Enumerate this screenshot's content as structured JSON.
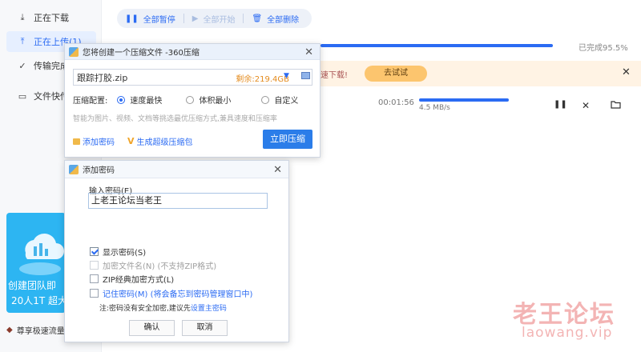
{
  "sidebar": {
    "items": [
      {
        "label": "正在下载",
        "icon": "download-icon"
      },
      {
        "label": "正在上传(1)",
        "icon": "upload-icon"
      },
      {
        "label": "传输完成",
        "icon": "check-circle-icon"
      },
      {
        "label": "文件快传",
        "icon": "monitor-icon"
      }
    ],
    "promo": {
      "line1": "创建团队即",
      "line2": "20人1T 超大"
    },
    "speed_label": "尊享极速流量"
  },
  "toolbar": {
    "pause_all": "全部暂停",
    "start_all": "全部开始",
    "delete_all": "全部删除"
  },
  "transfer": {
    "done_label": "已完成95.5%",
    "notice_text": "速下载!",
    "try_button": "去试试",
    "time": "00:01:56",
    "speed": "4.5 MB/s"
  },
  "compress_dialog": {
    "title": "您将创建一个压缩文件 -360压缩",
    "filename": "跟踪打胶.zip",
    "remaining": "剩余:219.4GB",
    "config_label": "压缩配置:",
    "options": [
      "速度最快",
      "体积最小",
      "自定义"
    ],
    "selected_option": "速度最快",
    "hint": "智能为图片、视频、文档等挑选最优压缩方式,兼具速度和压缩率",
    "add_password": "添加密码",
    "make_archive": "生成超级压缩包",
    "compress_button": "立即压缩"
  },
  "password_dialog": {
    "title": "添加密码",
    "input_label": "输入密码(E)",
    "password_value": "上老王论坛当老王",
    "show_password": "显示密码(S)",
    "encrypt_filename": "加密文件名(N) (不支持ZIP格式)",
    "zip_classic": "ZIP经典加密方式(L)",
    "remember": "记住密码(M) (将会备忘到密码管理窗口中)",
    "note_prefix": "注:密码没有安全加密,建议先",
    "note_link": "设置主密码",
    "ok_button": "确认",
    "cancel_button": "取消"
  },
  "watermark": {
    "title": "老王论坛",
    "url": "laowang.vip"
  },
  "colors": {
    "accent": "#2b6bf3",
    "promo": "#2db5f2",
    "notice": "#fff3e4",
    "try_button": "#fcc56e",
    "remaining": "#e48b1e"
  }
}
